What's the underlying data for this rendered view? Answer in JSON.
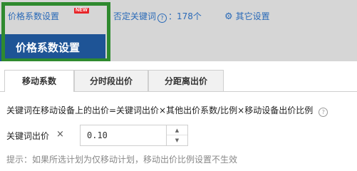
{
  "top_nav": {
    "tabs": [
      {
        "label": "价格系数设置",
        "badge": "NEW"
      },
      {
        "label": "否定关键词",
        "count_text": "：178个"
      },
      {
        "label": "其它设置"
      }
    ]
  },
  "panel": {
    "title": "价格系数设置",
    "tabs": [
      {
        "label": "移动系数"
      },
      {
        "label": "分时段出价"
      },
      {
        "label": "分距离出价"
      }
    ],
    "formula": "关键词在移动设备上的出价=关键词出价×其他出价系数/比例×移动设备出价比例",
    "bid_label": "关键词出价",
    "multiplier_symbol": "×",
    "ratio_value": "0.10",
    "hint": "提示：如果所选计划为仅移动计划，移动出价比例设置不生效"
  },
  "colors": {
    "link": "#2a6ab8",
    "title_bar": "#1e5496",
    "highlight": "#2f8a2f",
    "badge": "#e8262a"
  },
  "icons": {
    "help": "question-circle",
    "settings": "gear",
    "spin_up": "triangle-up",
    "spin_down": "triangle-down"
  }
}
